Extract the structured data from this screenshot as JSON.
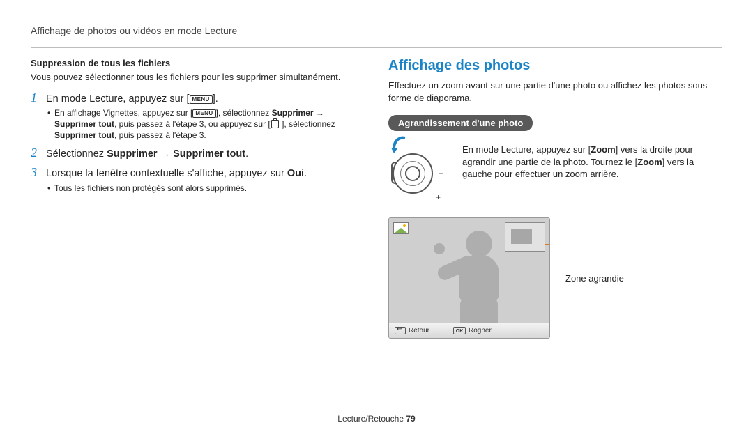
{
  "header": {
    "breadcrumb": "Affichage de photos ou vidéos en mode Lecture"
  },
  "left": {
    "subheading": "Suppression de tous les fichiers",
    "intro": "Vous pouvez sélectionner tous les fichiers pour les supprimer simultanément.",
    "steps": {
      "s1": {
        "num": "1",
        "pre": "En mode Lecture, appuyez sur [",
        "menu": "MENU",
        "post": "]."
      },
      "s1_bullet": {
        "a1": "En affichage Vignettes, appuyez sur [",
        "menu1": "MENU",
        "a2": "], sélectionnez ",
        "b1": "Supprimer",
        "a3": " → ",
        "b2": "Supprimer tout",
        "a4": ", puis passez à l'étape 3, ou appuyez sur [",
        "a5": " ], sélectionnez ",
        "b3": "Supprimer tout",
        "a6": ", puis passez à l'étape 3."
      },
      "s2": {
        "num": "2",
        "pre": "Sélectionnez ",
        "b1": "Supprimer",
        "arrow": " → ",
        "b2": "Supprimer tout",
        "post": "."
      },
      "s3": {
        "num": "3",
        "pre": "Lorsque la fenêtre contextuelle s'affiche, appuyez sur ",
        "b1": "Oui",
        "post": "."
      },
      "s3_bullet": "Tous les fichiers non protégés sont alors supprimés."
    }
  },
  "right": {
    "title": "Affichage des photos",
    "intro": "Effectuez un zoom avant sur une partie d'une photo ou affichez les photos sous forme de diaporama.",
    "pill": "Agrandissement d'une photo",
    "zoom_text": {
      "a1": "En mode Lecture, appuyez sur [",
      "b1": "Zoom",
      "a2": "] vers la droite pour agrandir une partie de la photo. Tournez le [",
      "b2": "Zoom",
      "a3": "] vers la gauche pour effectuer un zoom arrière."
    },
    "dial": {
      "minus": "−",
      "plus": "+"
    },
    "screen_bar": {
      "back": "Retour",
      "crop": "Rogner",
      "ok": "OK"
    },
    "zone_label": "Zone agrandie"
  },
  "footer": {
    "section": "Lecture/Retouche  ",
    "page": "79"
  }
}
